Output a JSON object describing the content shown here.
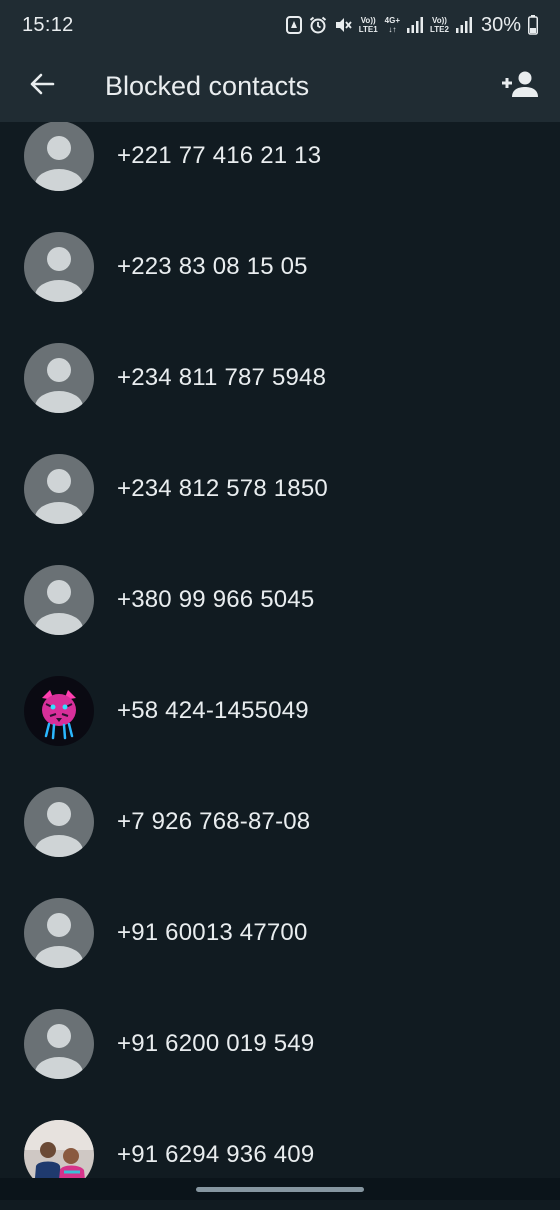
{
  "status_bar": {
    "time": "15:12",
    "sim1_label_top": "Vo))",
    "sim1_label_bottom": "LTE1",
    "net_label": "4G+",
    "sim2_label_top": "Vo))",
    "sim2_label_bottom": "LTE2",
    "battery": "30%"
  },
  "header": {
    "title": "Blocked contacts"
  },
  "contacts": [
    {
      "phone": "+221 77 416 21 13",
      "avatar": "default"
    },
    {
      "phone": "+223 83 08 15 05",
      "avatar": "default"
    },
    {
      "phone": "+234 811 787 5948",
      "avatar": "default"
    },
    {
      "phone": "+234 812 578 1850",
      "avatar": "default"
    },
    {
      "phone": "+380 99 966 5045",
      "avatar": "default"
    },
    {
      "phone": "+58 424-1455049",
      "avatar": "tiger"
    },
    {
      "phone": "+7 926 768-87-08",
      "avatar": "default"
    },
    {
      "phone": "+91 60013 47700",
      "avatar": "default"
    },
    {
      "phone": "+91 6200 019 549",
      "avatar": "default"
    },
    {
      "phone": "+91 6294 936 409",
      "avatar": "photo"
    }
  ],
  "colors": {
    "background": "#111b21",
    "header": "#202c33",
    "avatar_bg": "#6a7175",
    "avatar_fg": "#cfd4d6"
  }
}
